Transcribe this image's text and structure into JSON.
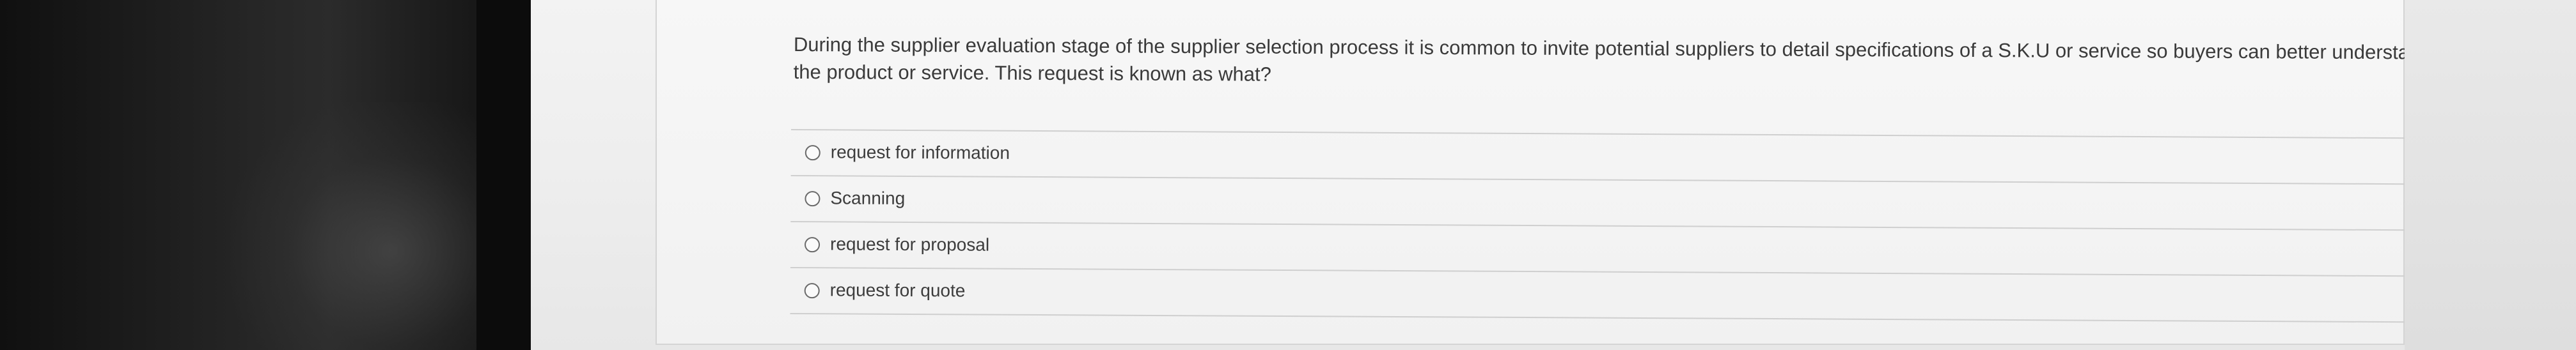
{
  "question": {
    "text": "During the supplier evaluation stage of the supplier selection process it is common to invite potential suppliers to detail specifications of a S.K.U or service so buyers can better understand the product or service. This request is known as what?"
  },
  "options": [
    {
      "label": "request for information",
      "selected": false
    },
    {
      "label": "Scanning",
      "selected": false
    },
    {
      "label": "request for proposal",
      "selected": false
    },
    {
      "label": "request for quote",
      "selected": false
    }
  ],
  "colors": {
    "background": "#f1f1f1",
    "text": "#3a3a3a",
    "divider": "#cfcfcf",
    "bezel": "#1b1b1b"
  }
}
